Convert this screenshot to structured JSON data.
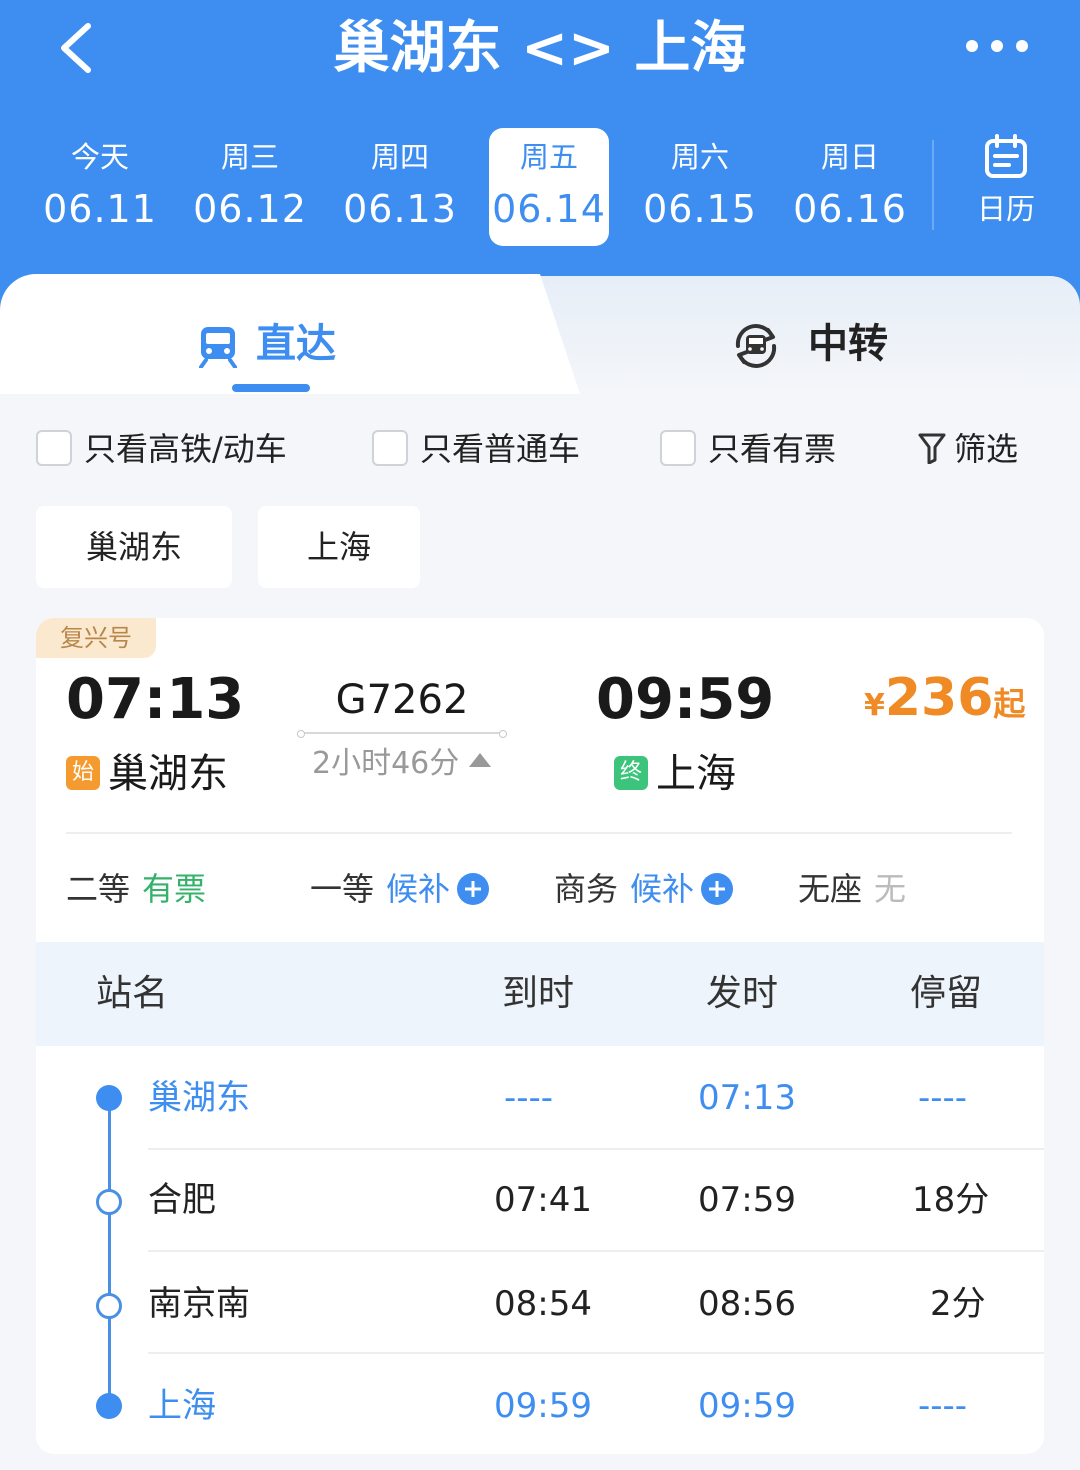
{
  "header": {
    "title": "巢湖东 <> 上海",
    "back_icon": "chevron-left-icon",
    "more_icon": "more-horizontal-icon"
  },
  "date_tabs": [
    {
      "dow": "今天",
      "date": "06.11",
      "active": false
    },
    {
      "dow": "周三",
      "date": "06.12",
      "active": false
    },
    {
      "dow": "周四",
      "date": "06.13",
      "active": false
    },
    {
      "dow": "周五",
      "date": "06.14",
      "active": true
    },
    {
      "dow": "周六",
      "date": "06.15",
      "active": false
    },
    {
      "dow": "周日",
      "date": "06.16",
      "active": false
    }
  ],
  "calendar": {
    "label": "日历",
    "icon": "calendar-icon"
  },
  "mode_tabs": {
    "direct": {
      "label": "直达",
      "icon": "train-icon",
      "active": true
    },
    "transfer": {
      "label": "中转",
      "icon": "transfer-train-icon",
      "active": false
    }
  },
  "filters": {
    "high_speed": "只看高铁/动车",
    "normal": "只看普通车",
    "available": "只看有票",
    "filter_btn": "筛选"
  },
  "station_chips": [
    "巢湖东",
    "上海"
  ],
  "train": {
    "badge": "复兴号",
    "number": "G7262",
    "depart_time": "07:13",
    "arrive_time": "09:59",
    "depart_station": "巢湖东",
    "arrive_station": "上海",
    "start_tag": "始",
    "end_tag": "终",
    "duration": "2小时46分",
    "price_symbol": "¥",
    "price": "236",
    "price_suffix": "起",
    "seats": [
      {
        "class": "二等",
        "status": "有票"
      },
      {
        "class": "一等",
        "status": "候补"
      },
      {
        "class": "商务",
        "status": "候补"
      },
      {
        "class": "无座",
        "status": "无"
      }
    ]
  },
  "stops": {
    "headers": {
      "name": "站名",
      "arrive": "到时",
      "depart": "发时",
      "stay": "停留"
    },
    "rows": [
      {
        "name": "巢湖东",
        "arrive": "----",
        "depart": "07:13",
        "stay": "----"
      },
      {
        "name": "合肥",
        "arrive": "07:41",
        "depart": "07:59",
        "stay": "18分"
      },
      {
        "name": "南京南",
        "arrive": "08:54",
        "depart": "08:56",
        "stay": "2分"
      },
      {
        "name": "上海",
        "arrive": "09:59",
        "depart": "09:59",
        "stay": "----"
      }
    ]
  },
  "colors": {
    "primary": "#3d8ef0",
    "available": "#34b26a",
    "price": "#f08a24",
    "badge_bg": "#fbe9cf"
  }
}
